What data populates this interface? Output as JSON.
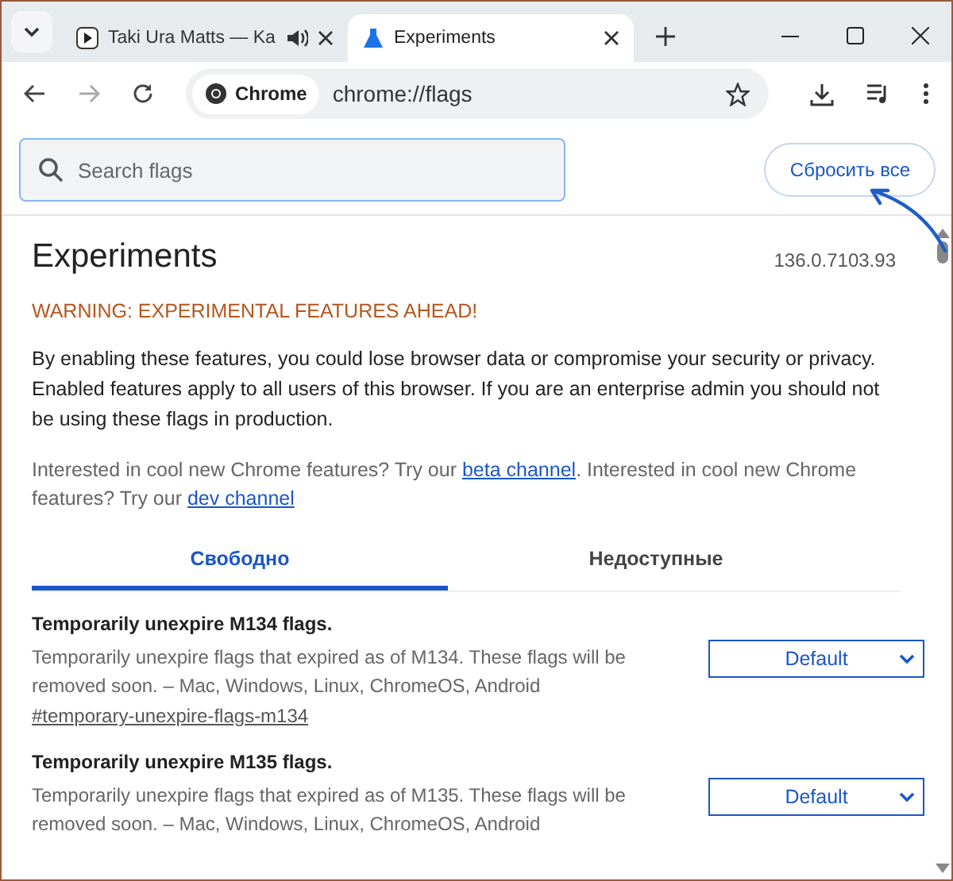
{
  "browser_tabs": [
    {
      "title": "Taki Ura Matts — Ka",
      "kind": "media",
      "selected": false,
      "audio": true
    },
    {
      "title": "Experiments",
      "kind": "flask",
      "selected": true,
      "audio": false
    }
  ],
  "toolbar": {
    "chip": "Chrome",
    "url": "chrome://flags"
  },
  "search": {
    "placeholder": "Search flags"
  },
  "reset_button": "Сбросить все",
  "page": {
    "title": "Experiments",
    "version": "136.0.7103.93",
    "warning": "WARNING: EXPERIMENTAL FEATURES AHEAD!",
    "intro": "By enabling these features, you could lose browser data or compromise your security or privacy. Enabled features apply to all users of this browser. If you are an enterprise admin you should not be using these flags in production.",
    "interest": [
      {
        "kind": "text",
        "text": "Interested in cool new Chrome features? Try our "
      },
      {
        "kind": "link",
        "text": "beta channel"
      },
      {
        "kind": "text",
        "text": ". Interested in cool new Chrome features? Try our "
      },
      {
        "kind": "link",
        "text": "dev channel"
      }
    ]
  },
  "filter_tabs": [
    {
      "label": "Свободно",
      "selected": true
    },
    {
      "label": "Недоступные",
      "selected": false
    }
  ],
  "flags": [
    {
      "title": "Temporarily unexpire M134 flags.",
      "description": "Temporarily unexpire flags that expired as of M134. These flags will be removed soon. – Mac, Windows, Linux, ChromeOS, Android",
      "link": "#temporary-unexpire-flags-m134",
      "value": "Default"
    },
    {
      "title": "Temporarily unexpire M135 flags.",
      "description": "Temporarily unexpire flags that expired as of M135. These flags will be removed soon. – Mac, Windows, Linux, ChromeOS, Android",
      "value": "Default"
    }
  ]
}
